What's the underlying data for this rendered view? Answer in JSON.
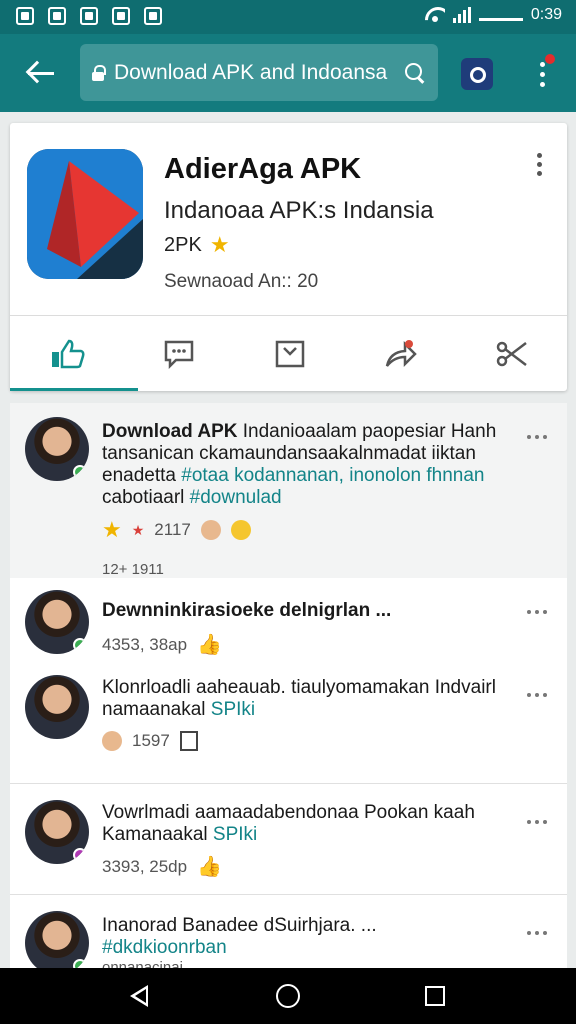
{
  "status_bar": {
    "time": "0:39"
  },
  "toolbar": {
    "search_text": "Download APK and Indoansa",
    "icons": [
      "back-arrow-icon",
      "lock-icon",
      "search-icon",
      "camera-icon",
      "more-vert-icon"
    ]
  },
  "app": {
    "name": "AdierAga APK",
    "subtitle": "Indanoaa APK:s Indansia",
    "rating": "2PK",
    "downloads": "Sewnaoad An:: 20"
  },
  "tabs": [
    "like",
    "comments",
    "save",
    "share",
    "cut"
  ],
  "posts": [
    {
      "text_lead": "Download APK",
      "text_rest": " Indanioaalam paopesiar Hanh tansanican ckamaundansaakalnmadat iiktan enadetta ",
      "hashtag1": "#otaa kodannanan, inonolon fhnnan",
      "text_mid": " cabotiaarl ",
      "hashtag2": "#downulad",
      "meta": "2117",
      "meta2": "12+ 1911"
    },
    {
      "text": "Dewnninkirasioeke delnigrlan ...",
      "meta": "4353, 38ap"
    },
    {
      "text_main": "Klonrloadli aaheauab. tiaulyomamakan Indvairl namaanakal ",
      "hashtag": "SPIki",
      "meta": "1597"
    },
    {
      "text_main": "Vowrlmadi aamaadabendonaa Pookan kaah Kamanaakal ",
      "hashtag": "SPIki",
      "meta": "3393, 25dp"
    },
    {
      "text": "Inanorad Banadee dSuirhjara. ...",
      "hashtag": "#dkdkioonrban",
      "meta": "onnanacinai"
    }
  ],
  "colors": {
    "teal_dark": "#0f6d70",
    "teal": "#137b7e",
    "accent": "#14918e",
    "hashtag": "#138488"
  }
}
